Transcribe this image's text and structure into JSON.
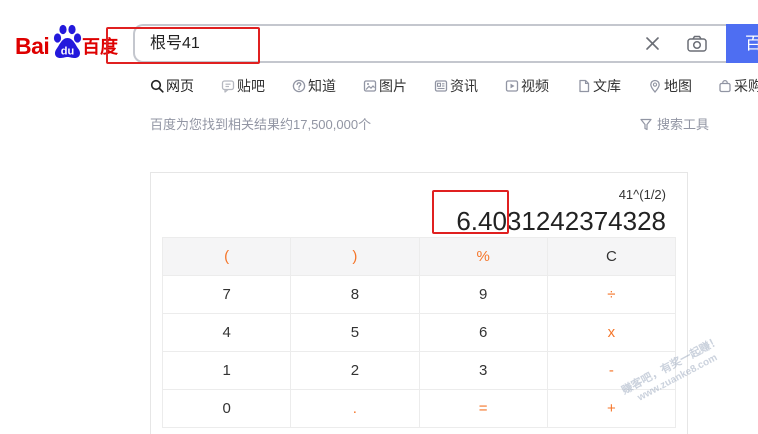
{
  "logo": {
    "part1": "Bai",
    "part2": "du",
    "part3": "百度"
  },
  "search": {
    "query": "根号41",
    "button_label": "百",
    "clear_icon": "close-icon",
    "camera_icon": "camera-icon"
  },
  "nav": {
    "items": [
      {
        "label": "网页",
        "icon": "search-icon"
      },
      {
        "label": "贴吧",
        "icon": "tieba-icon"
      },
      {
        "label": "知道",
        "icon": "question-icon"
      },
      {
        "label": "图片",
        "icon": "image-icon"
      },
      {
        "label": "资讯",
        "icon": "news-icon"
      },
      {
        "label": "视频",
        "icon": "video-icon"
      },
      {
        "label": "文库",
        "icon": "document-icon"
      },
      {
        "label": "地图",
        "icon": "map-icon"
      },
      {
        "label": "采购",
        "icon": "shopping-bag-icon"
      }
    ]
  },
  "result_count": "百度为您找到相关结果约17,500,000个",
  "search_tools": {
    "label": "搜索工具",
    "icon": "filter-icon"
  },
  "calculator": {
    "expression": "41^(1/2)",
    "result": "6.4031242374328",
    "keys": [
      [
        "(",
        ")",
        "%",
        "C"
      ],
      [
        "7",
        "8",
        "9",
        "÷"
      ],
      [
        "4",
        "5",
        "6",
        "x"
      ],
      [
        "1",
        "2",
        "3",
        "-"
      ],
      [
        "0",
        ".",
        "=",
        "+"
      ]
    ]
  },
  "watermark": {
    "line1": "赚客吧，有奖一起赚！",
    "line2": "www.zuanke8.com"
  },
  "colors": {
    "accent": "#4e6ef2",
    "logo_red": "#de0000",
    "logo_blue": "#2319dc",
    "operator": "#f5762a",
    "annotation": "#e02020",
    "muted_text": "#9195a3"
  }
}
